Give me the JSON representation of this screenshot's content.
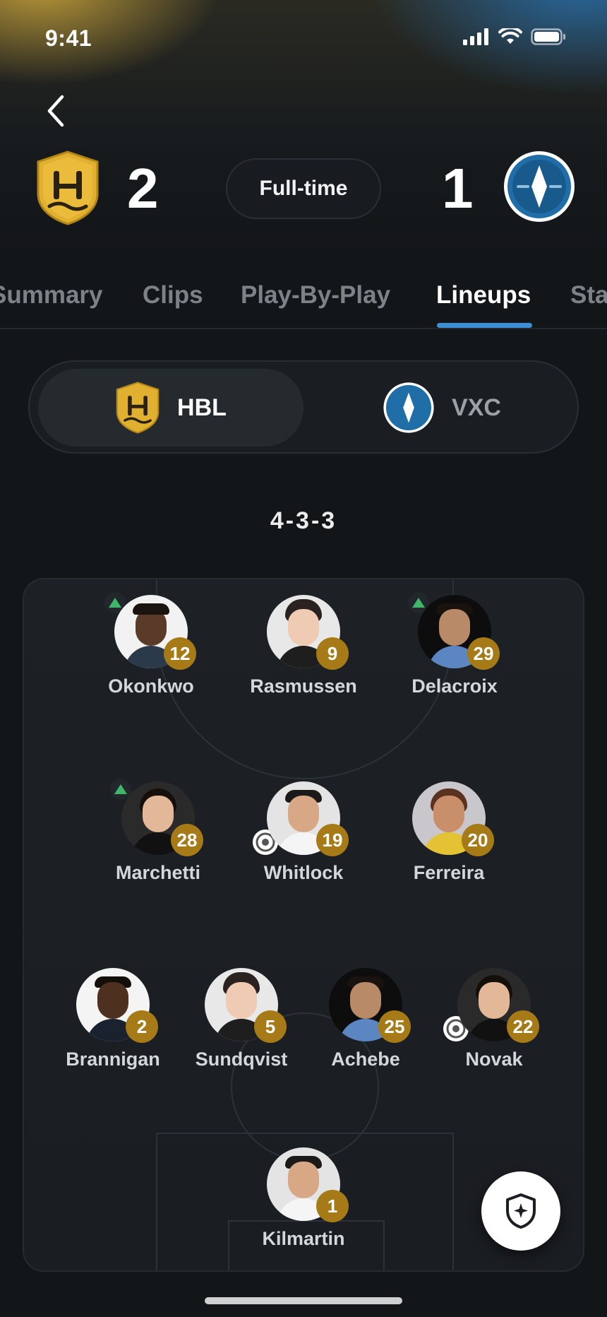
{
  "status_bar": {
    "time": "9:41"
  },
  "match": {
    "home": {
      "abbr": "HBL",
      "score": "2",
      "color": "#e2b030"
    },
    "away": {
      "abbr": "VXC",
      "score": "1",
      "color": "#1f6ea8"
    },
    "status": "Full-time"
  },
  "tabs": [
    {
      "label": "Summary",
      "active": false
    },
    {
      "label": "Clips",
      "active": false
    },
    {
      "label": "Play-By-Play",
      "active": false
    },
    {
      "label": "Lineups",
      "active": true
    },
    {
      "label": "Stats",
      "active": false
    }
  ],
  "team_toggle": {
    "selected": "HBL",
    "other": "VXC"
  },
  "formation": "4-3-3",
  "players": [
    {
      "name": "Okonkwo",
      "number": "12",
      "sub": true,
      "goal": false
    },
    {
      "name": "Rasmussen",
      "number": "9",
      "sub": false,
      "goal": false
    },
    {
      "name": "Delacroix",
      "number": "29",
      "sub": true,
      "goal": false
    },
    {
      "name": "Marchetti",
      "number": "28",
      "sub": true,
      "goal": false
    },
    {
      "name": "Whitlock",
      "number": "19",
      "sub": false,
      "goal": true
    },
    {
      "name": "Ferreira",
      "number": "20",
      "sub": false,
      "goal": false
    },
    {
      "name": "Brannigan",
      "number": "2",
      "sub": false,
      "goal": false
    },
    {
      "name": "Sundqvist",
      "number": "5",
      "sub": false,
      "goal": false
    },
    {
      "name": "Achebe",
      "number": "25",
      "sub": false,
      "goal": false
    },
    {
      "name": "Novak",
      "number": "22",
      "sub": false,
      "goal": true
    },
    {
      "name": "Kilmartin",
      "number": "1",
      "sub": false,
      "goal": false
    }
  ],
  "colors": {
    "accent": "#3b8fd6",
    "badge": "#a57a17",
    "sub_arrow": "#3fb66a",
    "background": "#131619"
  },
  "icons": {
    "fab": "shield-sparkle-icon",
    "back": "chevron-left-icon"
  }
}
